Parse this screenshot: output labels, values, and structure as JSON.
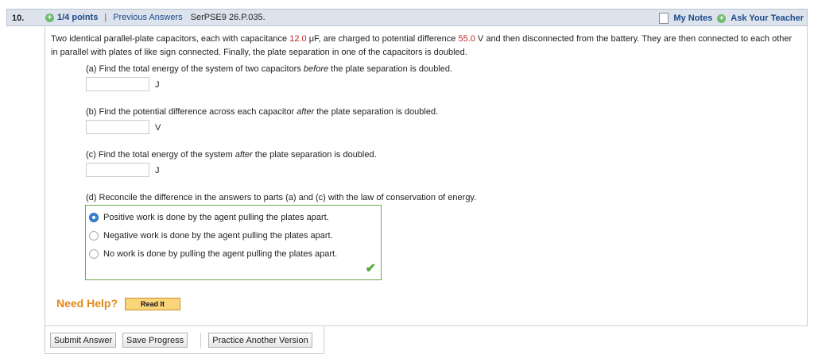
{
  "header": {
    "question_number": "10.",
    "points": "1/4 points",
    "separator": "|",
    "previous_answers": "Previous Answers",
    "problem_code": "SerPSE9 26.P.035.",
    "my_notes": "My Notes",
    "ask_teacher": "Ask Your Teacher"
  },
  "problem": {
    "p1": "Two identical parallel-plate capacitors, each with capacitance ",
    "capacitance": "12.0",
    "p2": " μF, are charged to potential difference ",
    "voltage": "55.0",
    "p3": " V and then disconnected from the battery. They are then connected to each other in parallel with plates of like sign connected. Finally, the plate separation in one of the capacitors is doubled."
  },
  "parts": {
    "a": {
      "pre": "(a) Find the total energy of the system of two capacitors ",
      "em": "before",
      "post": " the plate separation is doubled.",
      "unit": "J",
      "value": ""
    },
    "b": {
      "pre": "(b) Find the potential difference across each capacitor ",
      "em": "after",
      "post": " the plate separation is doubled.",
      "unit": "V",
      "value": ""
    },
    "c": {
      "pre": "(c) Find the total energy of the system ",
      "em": "after",
      "post": " the plate separation is doubled.",
      "unit": "J",
      "value": ""
    },
    "d": {
      "prompt": "(d) Reconcile the difference in the answers to parts (a) and (c) with the law of conservation of energy.",
      "options": [
        "Positive work is done by the agent pulling the plates apart.",
        "Negative work is done by the agent pulling the plates apart.",
        "No work is done by pulling the agent pulling the plates apart."
      ],
      "selected_index": 0
    }
  },
  "help": {
    "label": "Need Help?",
    "read_it": "Read It"
  },
  "buttons": {
    "submit": "Submit Answer",
    "save": "Save Progress",
    "practice": "Practice Another Version"
  },
  "colors": {
    "red_values": "#c0262b",
    "correct_border": "#69a84f",
    "link_blue": "#1b4a8a"
  }
}
